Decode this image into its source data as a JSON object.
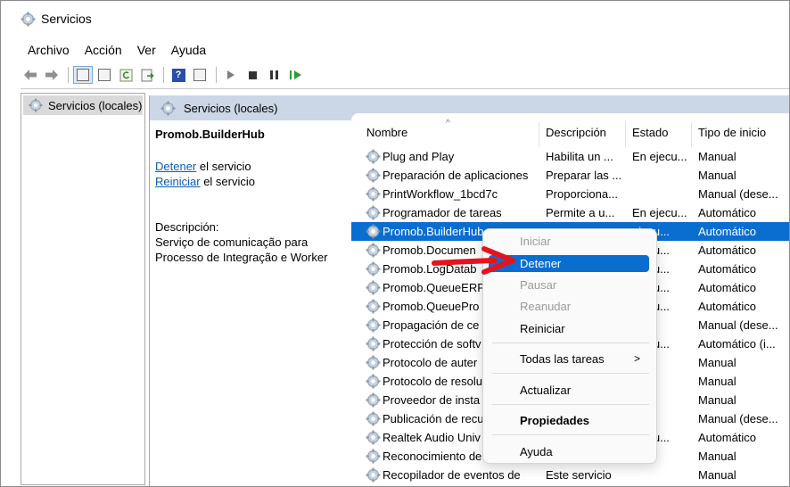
{
  "window": {
    "title": "Servicios"
  },
  "menu": [
    "Archivo",
    "Acción",
    "Ver",
    "Ayuda"
  ],
  "tree": {
    "root_label": "Servicios (locales)"
  },
  "pane": {
    "header": "Servicios (locales)",
    "service_name": "Promob.BuilderHub",
    "stop_link": "Detener",
    "stop_suffix": " el servicio",
    "restart_link": "Reiniciar",
    "restart_suffix": " el servicio",
    "description_label": "Descripción:",
    "description_line1": "Serviço de comunicação para",
    "description_line2": "Processo de Integração e Worker"
  },
  "columns": {
    "name": "Nombre",
    "description": "Descripción",
    "state": "Estado",
    "start_type": "Tipo de inicio"
  },
  "rows": [
    {
      "name": "Plug and Play",
      "description": "Habilita un ...",
      "state": "En ejecu...",
      "start_type": "Manual"
    },
    {
      "name": "Preparación de aplicaciones",
      "description": "Preparar las ...",
      "state": "",
      "start_type": "Manual"
    },
    {
      "name": "PrintWorkflow_1bcd7c",
      "description": "Proporciona...",
      "state": "",
      "start_type": "Manual (dese..."
    },
    {
      "name": "Programador de tareas",
      "description": "Permite a u...",
      "state": "En ejecu...",
      "start_type": "Automático"
    },
    {
      "name": "Promob.BuilderHub",
      "description": "",
      "state": "ejecu...",
      "start_type": "Automático",
      "selected": true
    },
    {
      "name": "Promob.Documen",
      "description": "",
      "state": "ejecu...",
      "start_type": "Automático"
    },
    {
      "name": "Promob.LogDatab",
      "description": "",
      "state": "ejecu...",
      "start_type": "Automático"
    },
    {
      "name": "Promob.QueueERP",
      "description": "",
      "state": "ejecu...",
      "start_type": "Automático"
    },
    {
      "name": "Promob.QueuePro",
      "description": "",
      "state": "ejecu...",
      "start_type": "Automático"
    },
    {
      "name": "Propagación de ce",
      "description": "",
      "state": "",
      "start_type": "Manual (dese..."
    },
    {
      "name": "Protección de softv",
      "description": "",
      "state": "ejecu...",
      "start_type": "Automático (i..."
    },
    {
      "name": "Protocolo de auter",
      "description": "",
      "state": "",
      "start_type": "Manual"
    },
    {
      "name": "Protocolo de resolu",
      "description": "",
      "state": "",
      "start_type": "Manual"
    },
    {
      "name": "Proveedor de insta",
      "description": "",
      "state": "",
      "start_type": "Manual"
    },
    {
      "name": "Publicación de recu",
      "description": "",
      "state": "",
      "start_type": "Manual (dese..."
    },
    {
      "name": "Realtek Audio Univ",
      "description": "",
      "state": "ejecu...",
      "start_type": "Automático"
    },
    {
      "name": "Reconocimiento de",
      "description": "",
      "state": "",
      "start_type": "Manual"
    },
    {
      "name": "Recopilador de eventos de",
      "description": "Este servicio",
      "state": "",
      "start_type": "Manual"
    }
  ],
  "context_menu": {
    "start": "Iniciar",
    "stop": "Detener",
    "pause": "Pausar",
    "resume": "Reanudar",
    "restart": "Reiniciar",
    "all_tasks": "Todas las tareas",
    "refresh": "Actualizar",
    "properties": "Propiedades",
    "help": "Ayuda"
  },
  "colors": {
    "selection": "#0a6ed1",
    "header_band": "#cbd6e6",
    "link": "#0b5fb3",
    "arrow": "#e3141b"
  }
}
